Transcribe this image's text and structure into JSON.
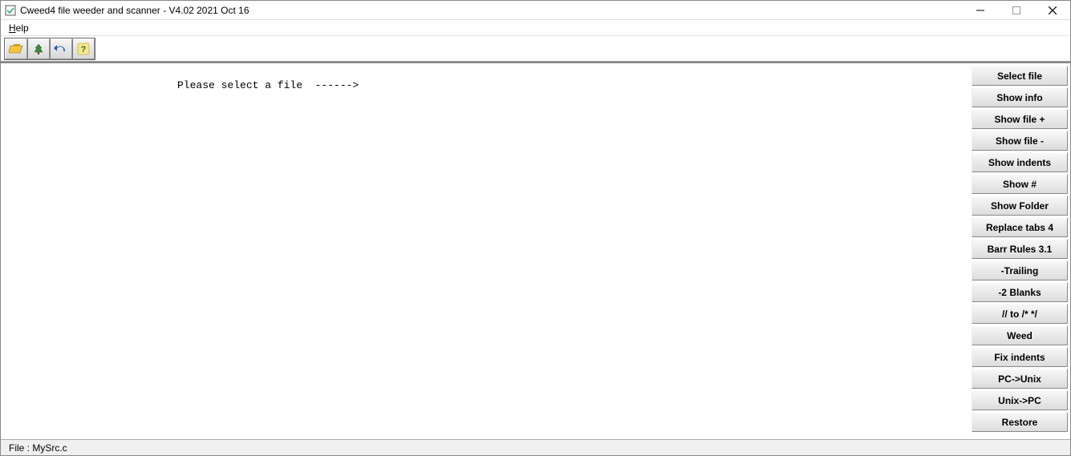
{
  "titlebar": {
    "title": "Cweed4 file weeder and scanner - V4.02 2021 Oct 16"
  },
  "menubar": {
    "help": "Help",
    "help_accel": "H"
  },
  "toolbar": {
    "icons": [
      "open-folder-icon",
      "tree-icon",
      "undo-icon",
      "help-icon"
    ]
  },
  "content": {
    "message": "Please select a file  ------>"
  },
  "right_buttons": [
    "Select file",
    "Show info",
    "Show file +",
    "Show file -",
    "Show indents",
    "Show #",
    "Show Folder",
    "Replace tabs 4",
    "Barr Rules 3.1",
    "-Trailing",
    "-2 Blanks",
    "// to /* */",
    "Weed",
    "Fix indents",
    "PC->Unix",
    "Unix->PC",
    "Restore"
  ],
  "statusbar": {
    "text": "File : MySrc.c"
  }
}
